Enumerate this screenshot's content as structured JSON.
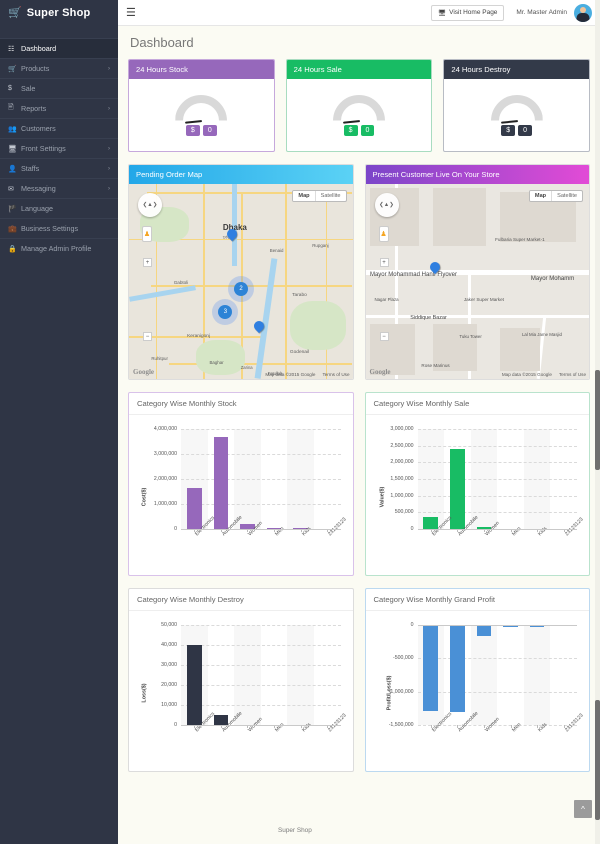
{
  "brand": {
    "name": "Super Shop",
    "icon": "shopping-cart-icon"
  },
  "sidebar": {
    "items": [
      {
        "label": "Dashboard",
        "icon": "dashboard-icon",
        "caret": "",
        "active": true
      },
      {
        "label": "Products",
        "icon": "cart-icon",
        "caret": "›",
        "active": false
      },
      {
        "label": "Sale",
        "icon": "dollar-icon",
        "caret": "",
        "active": false
      },
      {
        "label": "Reports",
        "icon": "file-icon",
        "caret": "›",
        "active": false
      },
      {
        "label": "Customers",
        "icon": "users-icon",
        "caret": "",
        "active": false
      },
      {
        "label": "Front Settings",
        "icon": "monitor-icon",
        "caret": "›",
        "active": false
      },
      {
        "label": "Staffs",
        "icon": "user-icon",
        "caret": "›",
        "active": false
      },
      {
        "label": "Messaging",
        "icon": "envelope-icon",
        "caret": "›",
        "active": false
      },
      {
        "label": "Language",
        "icon": "flag-icon",
        "caret": "",
        "active": false
      },
      {
        "label": "Business Settings",
        "icon": "briefcase-icon",
        "caret": "",
        "active": false
      },
      {
        "label": "Manage Admin Profile",
        "icon": "lock-icon",
        "caret": "",
        "active": false
      }
    ]
  },
  "topbar": {
    "menu_icon": "hamburger-icon",
    "visit_home_label": "Visit Home Page",
    "visit_home_icon": "monitor-icon",
    "username": "Mr. Master Admin",
    "avatar": "user-avatar"
  },
  "page": {
    "title": "Dashboard"
  },
  "stat_cards": [
    {
      "title": "24 Hours Stock",
      "currency": "$",
      "value": "0",
      "theme": "purple",
      "color": "#9668bb"
    },
    {
      "title": "24 Hours Sale",
      "currency": "$",
      "value": "0",
      "theme": "green",
      "color": "#18bc64"
    },
    {
      "title": "24 Hours Destroy",
      "currency": "$",
      "value": "0",
      "theme": "dark",
      "color": "#333a49"
    }
  ],
  "maps": [
    {
      "title": "Pending Order Map",
      "maptype_selected": "Map",
      "maptype_other": "Satellite",
      "attribution": "Map data ©2015 Google",
      "terms": "Terms of Use",
      "logo": "Google",
      "labels": [
        "Dhaka",
        "ঢাকা",
        "Gabtoli",
        "Keranigonj",
        "Ruhitpur",
        "Baghar",
        "Godenail",
        "Tarabo",
        "Benaid",
        "Rupganj",
        "Zarina",
        "Fatullah"
      ],
      "markers": [
        {
          "type": "pin",
          "x": 44,
          "y": 23
        },
        {
          "type": "cluster",
          "label": "2",
          "x": 47,
          "y": 50
        },
        {
          "type": "cluster",
          "label": "3",
          "x": 40,
          "y": 62
        },
        {
          "type": "pin",
          "x": 56,
          "y": 70
        }
      ]
    },
    {
      "title": "Present Customer Live On Your Store",
      "maptype_selected": "Map",
      "maptype_other": "Satellite",
      "attribution": "Map data ©2015 Google",
      "terms": "Terms of Use",
      "logo": "Google",
      "labels": [
        "Mayor Mohammad Hanif Flyover",
        "Mayor Mohamm",
        "Fulbaria Super Market-1",
        "Jaker Super Market",
        "Nagar Plaza",
        "Siddique Bazar",
        "Tuku Tower",
        "Lal Mia Jame Masjid",
        "Rose Marinus"
      ],
      "markers": [
        {
          "type": "pin",
          "x": 29,
          "y": 40
        }
      ]
    }
  ],
  "chart_data": [
    {
      "type": "bar",
      "title": "Category Wise Monthly Stock",
      "xlabel": "",
      "ylabel": "Cost($)",
      "categories": [
        "Electronics",
        "Automobile",
        "Women",
        "Men",
        "Kids",
        "23123123"
      ],
      "values": [
        1650000,
        3680000,
        190000,
        25000,
        25000,
        0
      ],
      "yticks": [
        "0",
        "1,000,000",
        "2,000,000",
        "3,000,000",
        "4,000,000"
      ],
      "ylim": [
        0,
        4000000
      ],
      "color": "#9668bb",
      "grid": true,
      "legend": "none",
      "theme": "b-purple"
    },
    {
      "type": "bar",
      "title": "Category Wise Monthly Sale",
      "xlabel": "",
      "ylabel": "Value($)",
      "categories": [
        "Electronics",
        "Automobile",
        "Women",
        "Men",
        "Kids",
        "23123123"
      ],
      "values": [
        350000,
        2400000,
        60000,
        0,
        10000,
        0
      ],
      "yticks": [
        "0",
        "500,000",
        "1,000,000",
        "1,500,000",
        "2,000,000",
        "2,500,000",
        "3,000,000"
      ],
      "ylim": [
        0,
        3000000
      ],
      "color": "#18bc64",
      "grid": true,
      "legend": "none",
      "theme": "b-green"
    },
    {
      "type": "bar",
      "title": "Category Wise Monthly Destroy",
      "xlabel": "",
      "ylabel": "Loss($)",
      "categories": [
        "Electronics",
        "Automobile",
        "Women",
        "Men",
        "Kids",
        "23123123"
      ],
      "values": [
        40000,
        5000,
        0,
        0,
        0,
        0
      ],
      "yticks": [
        "0",
        "10,000",
        "20,000",
        "30,000",
        "40,000",
        "50,000"
      ],
      "ylim": [
        0,
        50000
      ],
      "color": "#2f3545",
      "grid": true,
      "legend": "none",
      "theme": "b-gray"
    },
    {
      "type": "bar",
      "title": "Category Wise Monthly Grand Profit",
      "xlabel": "",
      "ylabel": "Profit/Loss($)",
      "categories": [
        "Electronics",
        "Automobile",
        "Women",
        "Men",
        "Kids",
        "23123123"
      ],
      "values": [
        -1290000,
        -1310000,
        -170000,
        -35000,
        -30000,
        0
      ],
      "yticks": [
        "0",
        "-500,000",
        "-1,000,000",
        "-1,500,000"
      ],
      "ylim": [
        -1500000,
        0
      ],
      "color": "#4a90d6",
      "grid": true,
      "legend": "none",
      "theme": "b-blue"
    }
  ],
  "footer": {
    "text": "Super Shop"
  },
  "scroll_top": {
    "icon": "chevron-up-icon"
  }
}
